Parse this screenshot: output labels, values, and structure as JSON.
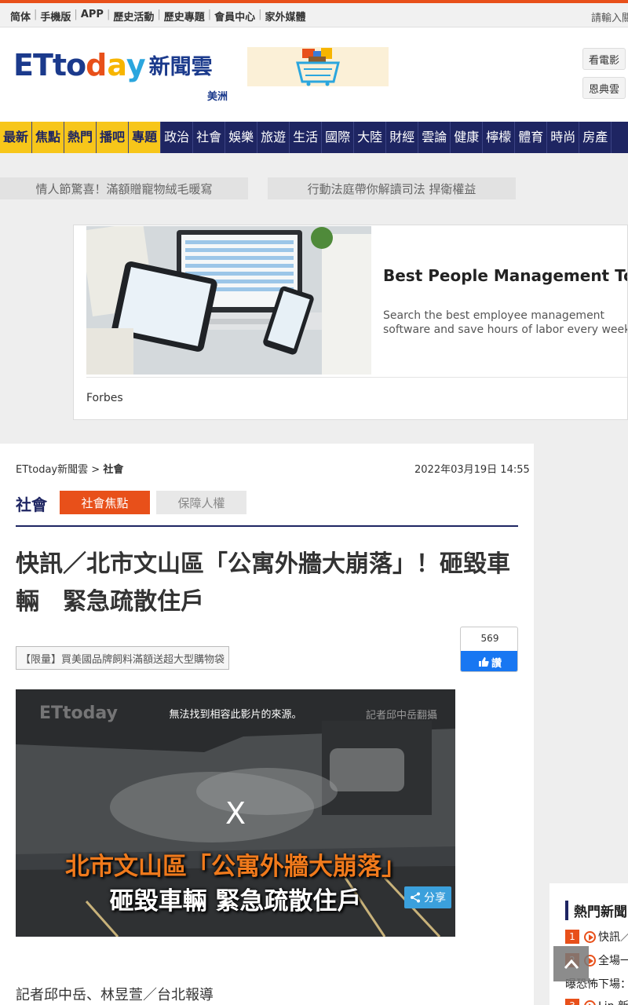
{
  "topbar": {
    "links": [
      "简体",
      "手機版",
      "APP",
      "歷史活動",
      "歷史專題",
      "會員中心",
      "家外媒體"
    ],
    "search_placeholder": "請輸入關"
  },
  "header": {
    "logo_et": "ETto",
    "logo_day": "day",
    "logo_cn": "新聞雲",
    "region": "美洲",
    "right_buttons": [
      "看電影",
      "恩典雲"
    ]
  },
  "nav": {
    "items": [
      "最新",
      "焦點",
      "熱門",
      "播吧",
      "專題",
      "政治",
      "社會",
      "娛樂",
      "旅遊",
      "生活",
      "國際",
      "大陸",
      "財經",
      "雲論",
      "健康",
      "檸檬",
      "體育",
      "時尚",
      "房產"
    ],
    "highlight_count": 5
  },
  "promos": [
    "情人節驚喜！滿額贈寵物絨毛暖寫",
    "行動法庭帶你解讀司法 捍衛權益"
  ],
  "ad": {
    "title": "Best People Management Tools",
    "text": "Search the best employee management software and save hours of labor every week.",
    "source": "Forbes"
  },
  "article": {
    "breadcrumb_home": "ETtoday新聞雲",
    "breadcrumb_sep": ">",
    "breadcrumb_section": "社會",
    "date": "2022年03月19日 14:55",
    "section": "社會",
    "tags": [
      "社會焦點",
      "保障人權"
    ],
    "headline": "快訊／北市文山區「公寓外牆大崩落」！砸毀車輛　緊急疏散住戶",
    "fb_count": "569",
    "fb_like": "讚",
    "limited": "【限量】買美國品牌飼料滿額送超大型購物袋",
    "byline": "記者邱中岳、林昱萱／台北報導"
  },
  "video": {
    "logo": "ETtoday",
    "message": "無法找到相容此影片的來源。",
    "credit": "記者邱中岳翻攝",
    "close": "X",
    "caption1": "北市文山區「公寓外牆大崩落」",
    "caption2": "砸毀車輛 緊急疏散住戶",
    "share": "分享"
  },
  "hot_news": {
    "title": "熱門新聞",
    "items": [
      {
        "num": "1",
        "text": "快訊／"
      },
      {
        "num": "2",
        "text": "全場一"
      },
      {
        "num": "",
        "text": "曝恐怖下場："
      },
      {
        "num": "3",
        "text": "Lin 新"
      }
    ]
  },
  "colors": {
    "brand_orange": "#e8501a",
    "navy": "#1e2562",
    "nav_highlight": "#f7c61a",
    "fb_blue": "#1877f2"
  }
}
